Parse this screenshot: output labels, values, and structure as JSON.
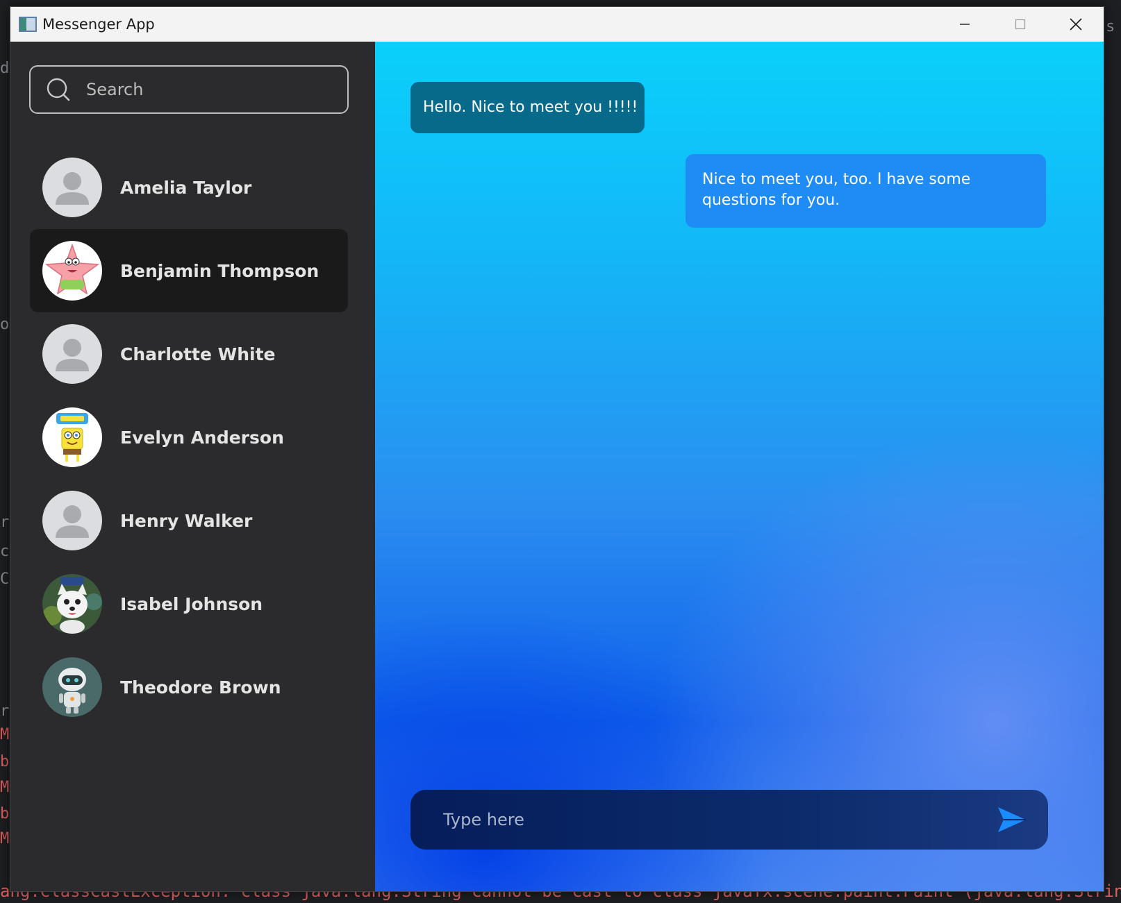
{
  "window": {
    "title": "Messenger App"
  },
  "search": {
    "placeholder": "Search"
  },
  "contacts": [
    {
      "name": "Amelia Taylor",
      "avatar": "default-avatar",
      "active": false
    },
    {
      "name": "Benjamin Thompson",
      "avatar": "patrick-star-avatar",
      "active": true
    },
    {
      "name": "Charlotte White",
      "avatar": "default-avatar",
      "active": false
    },
    {
      "name": "Evelyn Anderson",
      "avatar": "spongebob-avatar",
      "active": false
    },
    {
      "name": "Henry Walker",
      "avatar": "default-avatar",
      "active": false
    },
    {
      "name": "Isabel Johnson",
      "avatar": "white-dog-avatar",
      "active": false
    },
    {
      "name": "Theodore Brown",
      "avatar": "robot-avatar",
      "active": false
    }
  ],
  "messages": [
    {
      "direction": "incoming",
      "text": "Hello. Nice to meet you !!!!!"
    },
    {
      "direction": "outgoing",
      "text": "Nice to meet you, too. I have some questions for you."
    }
  ],
  "composer": {
    "placeholder": "Type here"
  },
  "background": {
    "side_fragments": [
      "ds",
      "o",
      "re",
      "c",
      "C",
      "rı",
      "M",
      "bo",
      "M",
      "bo",
      "M",
      "s"
    ],
    "error_line": "ang.ClassCastException: class java.lang.String cannot be cast to class javafx.scene.paint.Paint (java.lang.String is"
  },
  "colors": {
    "sidebar_bg": "#2b2b2d",
    "active_contact_bg": "#1a1a1b",
    "incoming_bubble": "#076a8a",
    "outgoing_bubble": "#1e8cf4",
    "send_icon": "#1a8cff"
  }
}
